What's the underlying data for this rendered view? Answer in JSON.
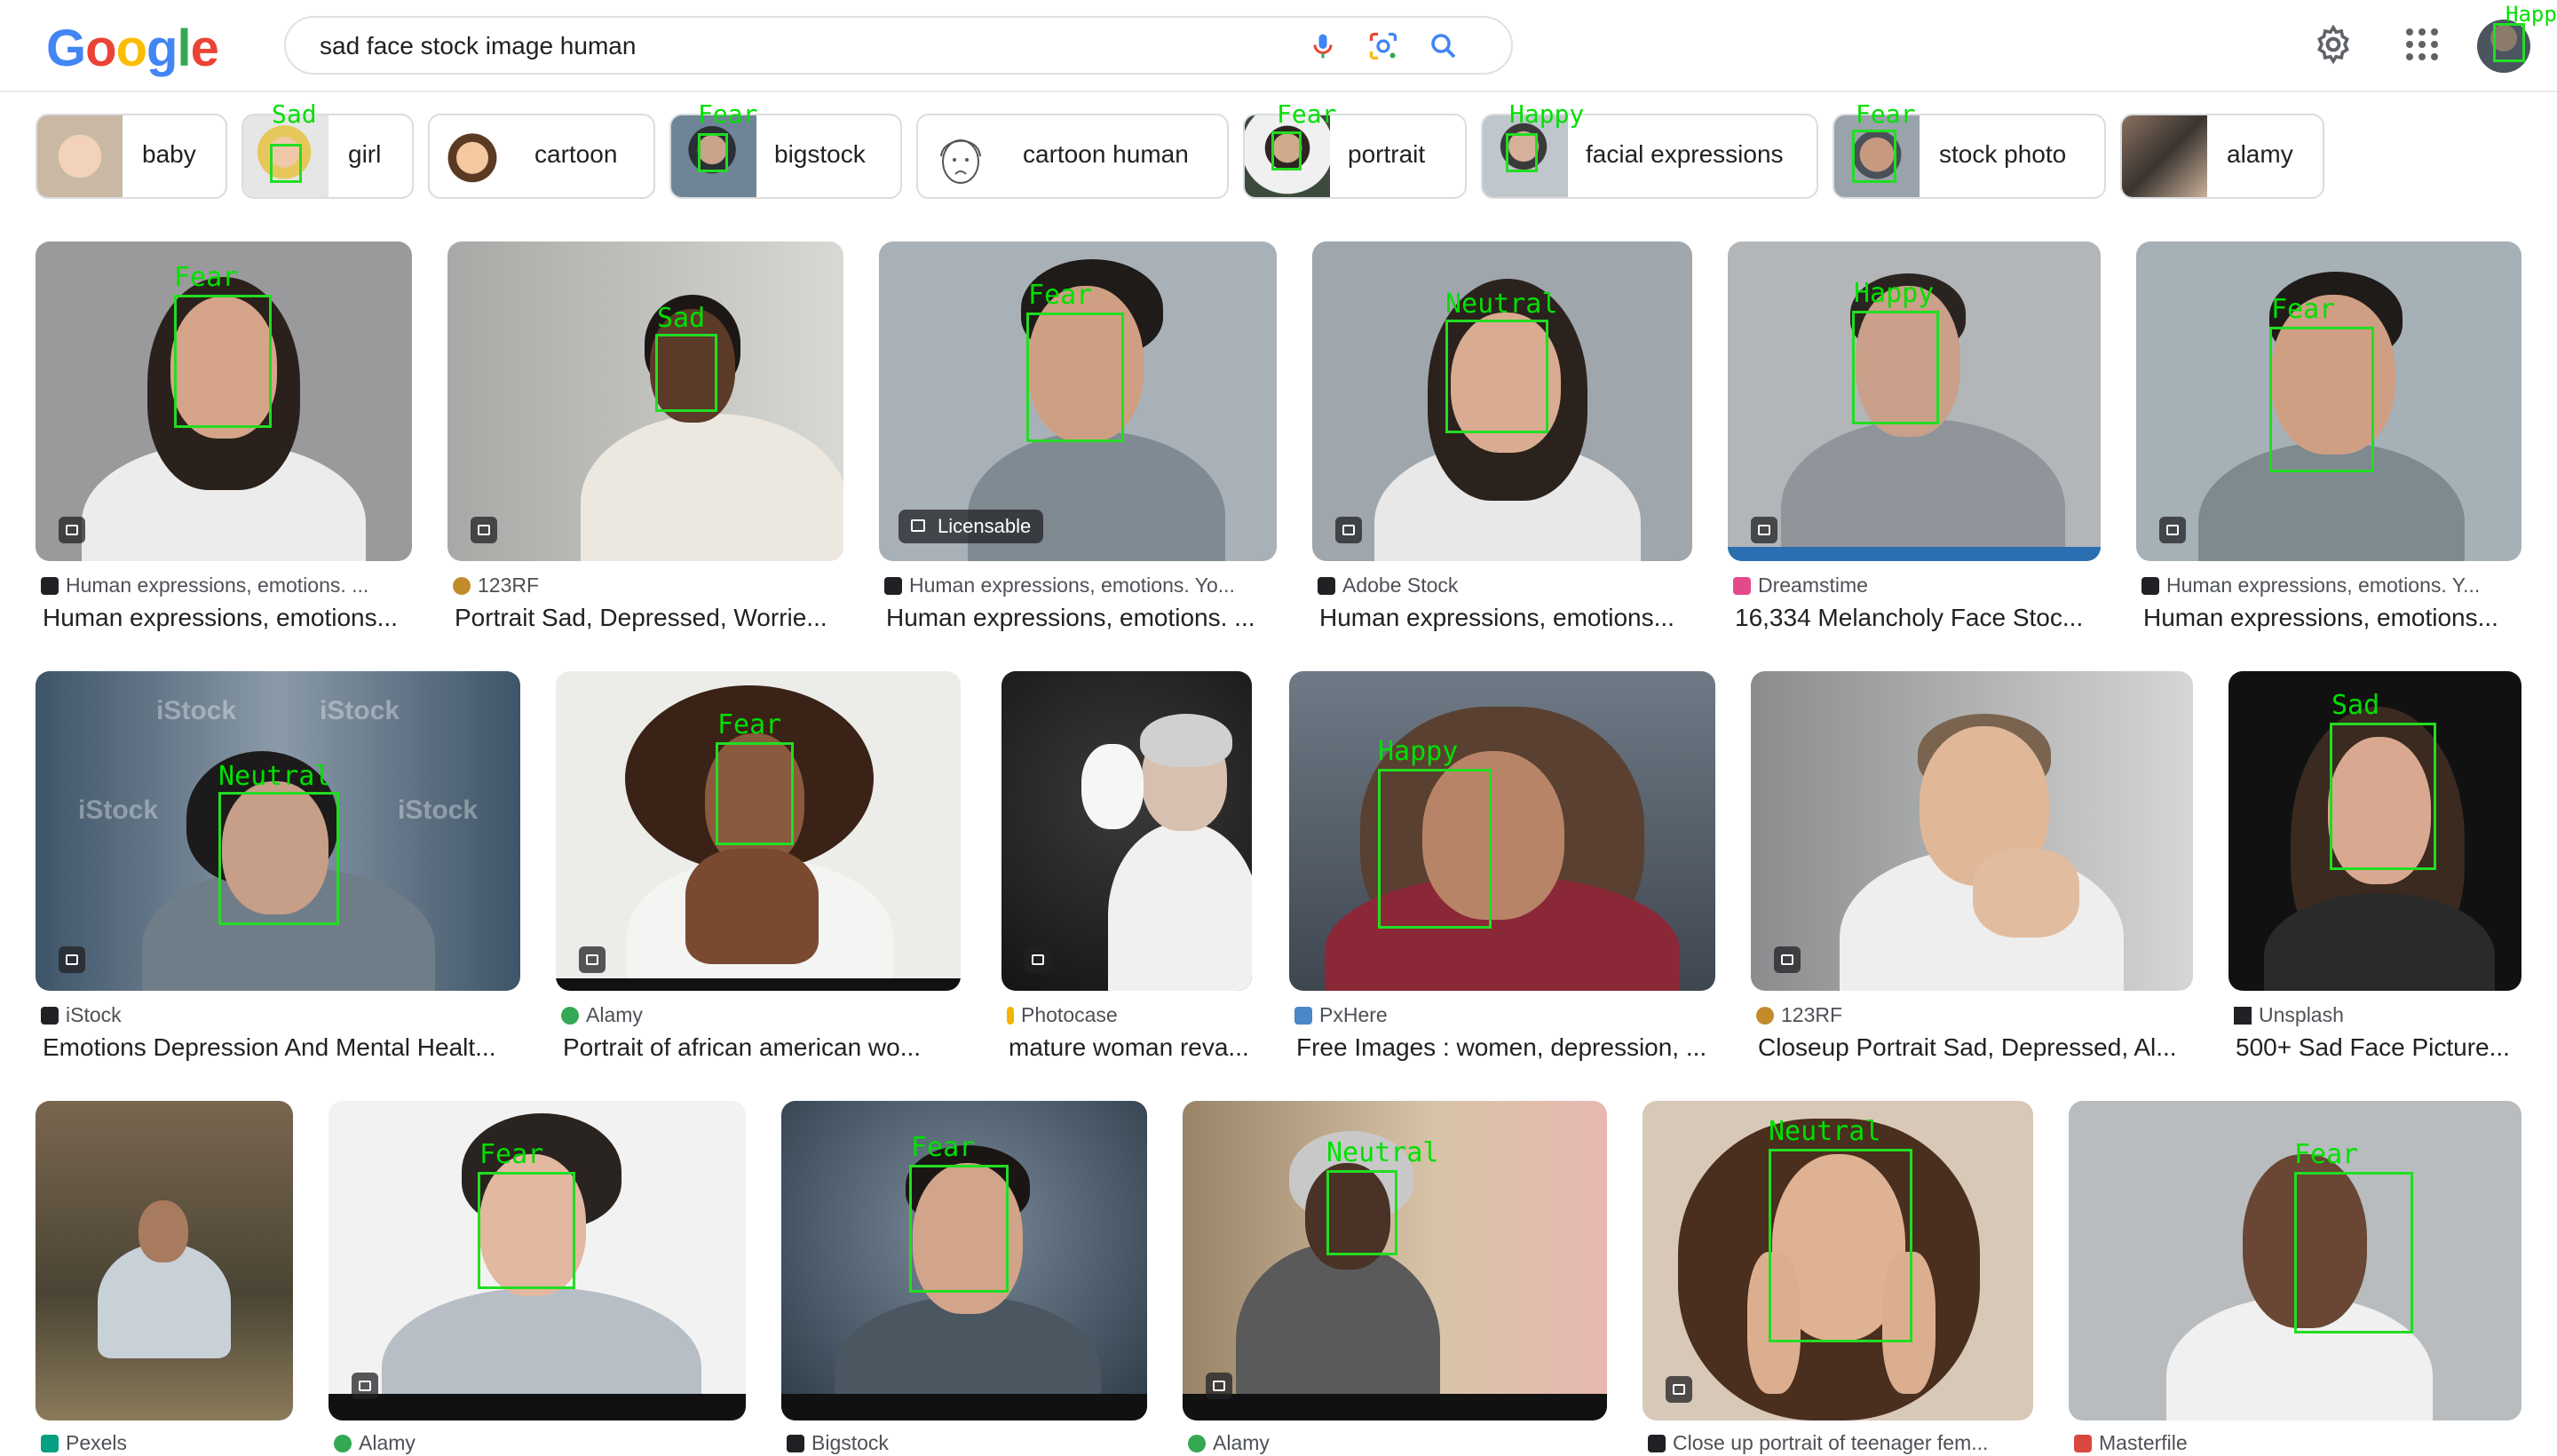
{
  "logo": "Google",
  "search": {
    "query": "sad face stock image human"
  },
  "header": {
    "avatar_tag": "Happ"
  },
  "colors": {
    "accent": "#4285f4",
    "face_detection_box": "#22dd22",
    "face_detection_label": "#00e000"
  },
  "chips": [
    {
      "label": "baby",
      "tag": ""
    },
    {
      "label": "girl",
      "tag": "Sad"
    },
    {
      "label": "cartoon",
      "tag": ""
    },
    {
      "label": "bigstock",
      "tag": "Fear"
    },
    {
      "label": "cartoon human",
      "tag": ""
    },
    {
      "label": "portrait",
      "tag": "Fear"
    },
    {
      "label": "facial expressions",
      "tag": "Happy"
    },
    {
      "label": "stock photo",
      "tag": "Fear"
    },
    {
      "label": "alamy",
      "tag": ""
    }
  ],
  "results": [
    {
      "source": "Human expressions, emotions. ...",
      "title": "Human expressions, emotions...",
      "emotion": "Fear"
    },
    {
      "source": "123RF",
      "title": "Portrait Sad, Depressed, Worrie...",
      "emotion": "Sad"
    },
    {
      "source": "Human expressions, emotions. Yo...",
      "title": "Human expressions, emotions. ...",
      "emotion": "Fear",
      "badge": "Licensable"
    },
    {
      "source": "Adobe Stock",
      "title": "Human expressions, emotions...",
      "emotion": "Neutral"
    },
    {
      "source": "Dreamstime",
      "title": "16,334 Melancholy Face Stoc...",
      "emotion": "Happy"
    },
    {
      "source": "Human expressions, emotions. Y...",
      "title": "Human expressions, emotions...",
      "emotion": "Fear"
    },
    {
      "source": "iStock",
      "title": "Emotions Depression And Mental Healt...",
      "emotion": "Neutral",
      "watermark": "iStock"
    },
    {
      "source": "Alamy",
      "title": "Portrait of african american wo...",
      "emotion": "Fear"
    },
    {
      "source": "Photocase",
      "title": "mature woman reva...",
      "emotion": ""
    },
    {
      "source": "PxHere",
      "title": "Free Images : women, depression, ...",
      "emotion": "Happy"
    },
    {
      "source": "123RF",
      "title": "Closeup Portrait Sad, Depressed, Al...",
      "emotion": ""
    },
    {
      "source": "Unsplash",
      "title": "500+ Sad Face Picture...",
      "emotion": "Sad"
    },
    {
      "source": "Pexels",
      "title": "",
      "emotion": ""
    },
    {
      "source": "Alamy",
      "title": "",
      "emotion": "Fear"
    },
    {
      "source": "Bigstock",
      "title": "",
      "emotion": "Fear"
    },
    {
      "source": "Alamy",
      "title": "",
      "emotion": "Neutral"
    },
    {
      "source": "Close up portrait of teenager fem...",
      "title": "",
      "emotion": "Neutral"
    },
    {
      "source": "Masterfile",
      "title": "",
      "emotion": "Fear"
    }
  ]
}
